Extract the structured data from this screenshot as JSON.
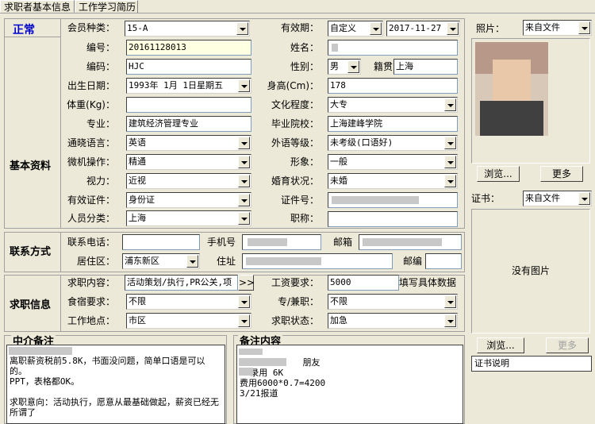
{
  "tabs": [
    "求职者基本信息",
    "工作学习简历"
  ],
  "status": {
    "text": "正常",
    "color": "#0000cc"
  },
  "sections": {
    "basic": "基本资料",
    "contact": "联系方式",
    "jobsearch": "求职信息"
  },
  "labels": {
    "member_type": "会员种类：",
    "validity": "有效期：",
    "number": "编号：",
    "name": "姓名：",
    "code": "编码：",
    "gender": "性别：",
    "native_place": "籍贯",
    "birth_date": "出生日期：",
    "height": "身高(Cm)：",
    "weight": "体重(Kg)：",
    "education": "文化程度：",
    "major": "专业：",
    "graduate_school": "毕业院校：",
    "language": "通晓语言：",
    "foreign_level": "外语等级：",
    "computer": "微机操作：",
    "appearance": "形象：",
    "eyesight": "视力：",
    "marital": "婚育状况：",
    "id_type": "有效证件：",
    "id_number": "证件号：",
    "category": "人员分类：",
    "title": "职称：",
    "phone": "联系电话：",
    "mobile": "手机号",
    "email": "邮箱",
    "district": "居住区：",
    "address": "住址",
    "postcode": "邮编",
    "job_content": "求职内容：",
    "salary": "工资要求：",
    "salary_hint": "填写具体数据",
    "board": "食宿要求：",
    "fulltime": "专/兼职：",
    "work_place": "工作地点：",
    "job_status": "求职状态：",
    "photo": "照片：",
    "certificate": "证书："
  },
  "values": {
    "member_type": "15-A",
    "validity_mode": "自定义",
    "validity_date": "2017-11-27",
    "number": "20161128013",
    "name": "",
    "code": "HJC",
    "gender": "男",
    "native_place": "上海",
    "birth_date": "1993年 1月 1日星期五",
    "height": "178",
    "weight": "",
    "education": "大专",
    "major": "建筑经济管理专业",
    "graduate_school": "上海建峰学院",
    "language": "英语",
    "foreign_level": "未考级(口语好)",
    "computer": "精通",
    "appearance": "一般",
    "eyesight": "近视",
    "marital": "未婚",
    "id_type": "身份证",
    "id_number": "",
    "category": "上海",
    "title": "",
    "phone": "",
    "mobile": "",
    "email": "",
    "district": "浦东新区",
    "address": "",
    "postcode": "",
    "job_content": "活动策划/执行,PR公关,项",
    "salary": "5000",
    "board": "不限",
    "fulltime": "不限",
    "work_place": "市区",
    "job_status": "加急"
  },
  "photo_source": "来自文件",
  "cert_source": "来自文件",
  "buttons": {
    "browse": "浏览...",
    "more": "更多",
    "expand": ">>"
  },
  "no_image": "没有图片",
  "memo1": {
    "title": "中介备注",
    "text": "离职薪资税前5.8K，书面没问题，简单口语是可以的。\nPPT，表格都OK。\n\n求职意向：活动执行，愿意从最基础做起，薪资已经无所谓了"
  },
  "memo2": {
    "title": "备注内容",
    "text": "\n            朋友\n  录用 6K\n费用6000*0.7=4200\n3/21报道"
  },
  "cert_note": "证书说明",
  "icons": {
    "dropdown": "chevron-down-icon"
  }
}
